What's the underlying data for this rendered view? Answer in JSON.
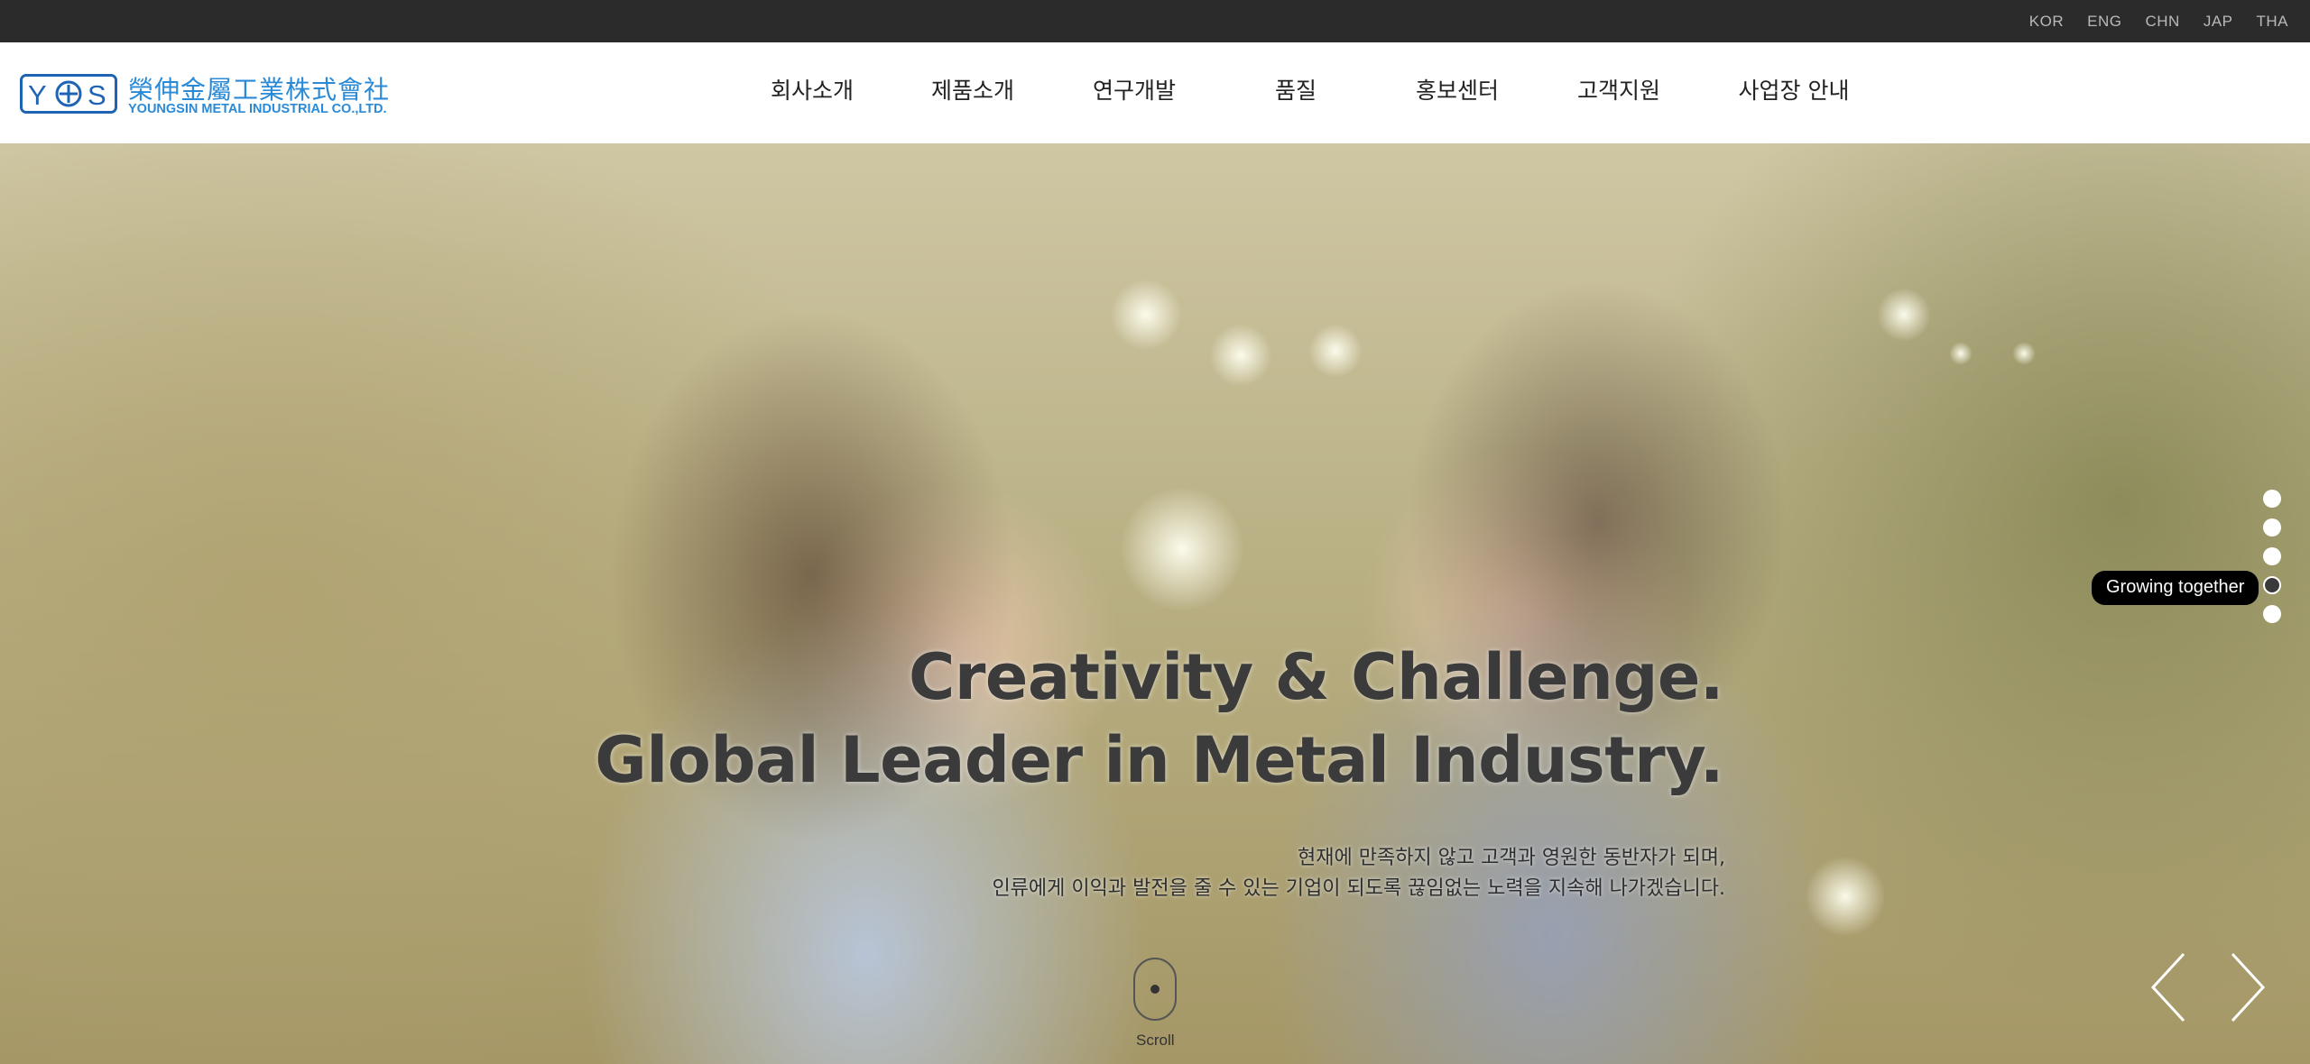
{
  "languages": [
    "KOR",
    "ENG",
    "CHN",
    "JAP",
    "THA"
  ],
  "logo": {
    "mark": "Y+S",
    "name_cn": "榮伸金屬工業株式會社",
    "name_en": "YOUNGSIN METAL INDUSTRIAL CO.,LTD."
  },
  "nav": [
    {
      "label": "회사소개"
    },
    {
      "label": "제품소개"
    },
    {
      "label": "연구개발"
    },
    {
      "label": "품질"
    },
    {
      "label": "홍보센터"
    },
    {
      "label": "고객지원"
    },
    {
      "label": "사업장 안내"
    }
  ],
  "hero": {
    "headline_1": "Creativity & Challenge.",
    "headline_2": "Global Leader in Metal Industry.",
    "sub_1": "현재에 만족하지 않고 고객과 영원한 동반자가 되며,",
    "sub_2": "인류에게 이익과 발전을 줄 수 있는 기업이 되도록 끊임없는 노력을 지속해 나가겠습니다.",
    "scroll_label": "Scroll"
  },
  "slider": {
    "slide_count": 5,
    "active_index": 3,
    "active_tooltip": "Growing together"
  },
  "colors": {
    "topbar_bg": "#2b2b2b",
    "brand_blue": "#2a8ad6"
  },
  "icons": {
    "prev": "chevron-left-icon",
    "next": "chevron-right-icon",
    "scroll": "mouse-icon"
  }
}
